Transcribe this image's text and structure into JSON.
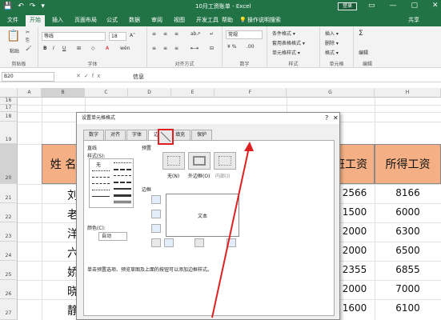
{
  "titlebar": {
    "title": "10月工资账单 - Excel",
    "login": "登录",
    "qat": [
      "💾",
      "↶",
      "↷",
      "▾"
    ],
    "win": [
      "▭",
      "—",
      "▢",
      "✕"
    ]
  },
  "tabs": [
    "文件",
    "开始",
    "插入",
    "页面布局",
    "公式",
    "数据",
    "审阅",
    "视图",
    "开发工具",
    "帮助",
    "💡",
    "操作说明搜索"
  ],
  "share": "共享",
  "ribbon": {
    "clipboard": {
      "label": "剪贴板",
      "paste": "粘贴"
    },
    "font": {
      "label": "字体",
      "name": "等线",
      "size": "18"
    },
    "alignment": {
      "label": "对齐方式"
    },
    "number": {
      "label": "数字",
      "format": "常规"
    },
    "styles": {
      "label": "样式",
      "items": [
        "条件格式 ▾",
        "套用表格格式 ▾",
        "单元格样式 ▾"
      ]
    },
    "cells": {
      "label": "单元格",
      "items": [
        "插入 ▾",
        "删除 ▾",
        "格式 ▾"
      ]
    },
    "editing": {
      "label": "编辑",
      "items": [
        "编辑"
      ]
    }
  },
  "formula": {
    "cell": "B20",
    "content": "信息",
    "fx": "✕✓fx"
  },
  "columns": [
    "A",
    "B",
    "C",
    "D",
    "E",
    "F",
    "G",
    "H"
  ],
  "rows": [
    "16",
    "17",
    "18",
    "19",
    "20",
    "21",
    "22",
    "23",
    "24",
    "25",
    "26",
    "27"
  ],
  "sheet": {
    "hdr_name": "姓 名",
    "hdr_g": "班工资",
    "hdr_h": "所得工资",
    "names": [
      "刘",
      "老",
      "洋",
      "六",
      "娇",
      "晓",
      "静"
    ],
    "g_values": [
      "2566",
      "1500",
      "2000",
      "2000",
      "2355",
      "2000",
      "1600"
    ],
    "h_values": [
      "8166",
      "6000",
      "6300",
      "6500",
      "6855",
      "7000",
      "6100"
    ]
  },
  "dialog": {
    "title": "设置单元格格式",
    "tabs": [
      "数字",
      "对齐",
      "字体",
      "边框",
      "填充",
      "保护"
    ],
    "line_section": "直线",
    "style_label": "样式(S):",
    "none_label": "无",
    "color_label": "颜色(C):",
    "color_value": "自动",
    "preset_label": "预置",
    "presets": [
      "无(N)",
      "外边框(O)",
      "内部(I)"
    ],
    "border_label": "边框",
    "preview_text": "文本",
    "hint": "单击预置选项、预览草图及上面的按钮可以添加边框样式。"
  }
}
